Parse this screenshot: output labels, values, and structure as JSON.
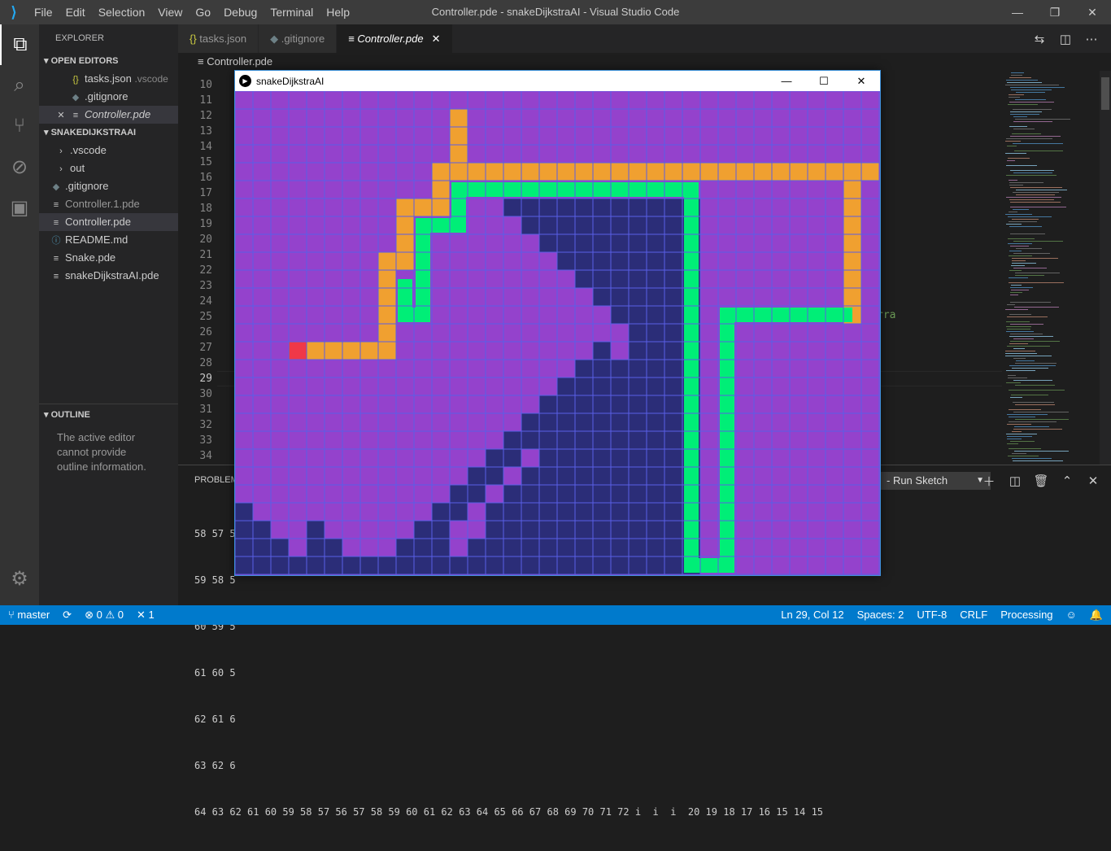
{
  "window": {
    "title": "Controller.pde - snakeDijkstraAI - Visual Studio Code",
    "menu": [
      "File",
      "Edit",
      "Selection",
      "View",
      "Go",
      "Debug",
      "Terminal",
      "Help"
    ]
  },
  "sidebar": {
    "header": "EXPLORER",
    "open_editors_title": "OPEN EDITORS",
    "open_editors": [
      {
        "name": "tasks.json",
        "sub": ".vscode"
      },
      {
        "name": ".gitignore",
        "sub": ""
      },
      {
        "name": "Controller.pde",
        "sub": ""
      }
    ],
    "project_title": "SNAKEDIJKSTRAAI",
    "files": [
      ".vscode",
      "out",
      ".gitignore",
      "Controller.1.pde",
      "Controller.pde",
      "README.md",
      "Snake.pde",
      "snakeDijkstraAI.pde"
    ],
    "outline_title": "OUTLINE",
    "outline_message": "The active editor cannot provide outline information."
  },
  "tabs": [
    {
      "label": "tasks.json"
    },
    {
      "label": ".gitignore"
    },
    {
      "label": "Controller.pde"
    }
  ],
  "breadcrumb": "Controller.pde",
  "editor": {
    "line_numbers": [
      "10",
      "11",
      "12",
      "13",
      "14",
      "15",
      "16",
      "17",
      "18",
      "19",
      "20",
      "21",
      "22",
      "23",
      "24",
      "25",
      "26",
      "27",
      "28",
      "29",
      "30",
      "31",
      "32",
      "33",
      "34"
    ],
    "current_line": "29",
    "code_fragment": "rra"
  },
  "panel": {
    "title": "PROBLEMS",
    "task_select": "- Run Sketch",
    "terminal_lines": [
      "58 57 5",
      "59 58 5",
      "60 59 5",
      "61 60 5",
      "62 61 6",
      "63 62 6",
      "64 63 62 61 60 59 58 57 56 57 58 59 60 61 62 63 64 65 66 67 68 69 70 71 72 i  i  i  20 19 18 17 16 15 14 15"
    ]
  },
  "statusbar": {
    "branch": "master",
    "errors": "0",
    "warnings": "0",
    "tools": "1",
    "position": "Ln 29, Col 12",
    "spaces": "Spaces: 2",
    "encoding": "UTF-8",
    "eol": "CRLF",
    "language": "Processing"
  },
  "sketch": {
    "title": "snakeDijkstraAI",
    "colors": {
      "background": "#9442cc",
      "grid": "#5a5ee6",
      "visited": "#2b2d78",
      "path": "#f0a030",
      "snake": "#00ee77",
      "head": "#f03848"
    }
  }
}
